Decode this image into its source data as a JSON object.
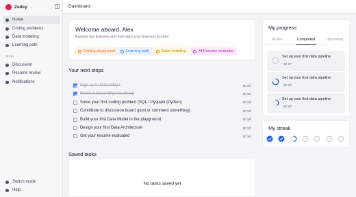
{
  "app": {
    "name": "Zedsy"
  },
  "sidebar": {
    "items": [
      {
        "label": "Home",
        "active": true
      },
      {
        "label": "Coding problems"
      },
      {
        "label": "Data modeling"
      },
      {
        "label": "Learning path"
      }
    ],
    "more_label": "More",
    "more_items": [
      {
        "label": "Discussion"
      },
      {
        "label": "Resume review"
      },
      {
        "label": "Notifications"
      }
    ],
    "bottom_items": [
      {
        "label": "Switch mode"
      },
      {
        "label": "Help"
      }
    ]
  },
  "header": {
    "title": "Dashboard"
  },
  "welcome": {
    "title": "Welcome aboard, Alex",
    "subtitle": "Explore our features and kick-start your learning journey",
    "chips": [
      {
        "label": "Coding playground",
        "color": "#f97316",
        "bg": "#fff1e6"
      },
      {
        "label": "Learning path",
        "color": "#3b82f6",
        "bg": "#e8f1fe"
      },
      {
        "label": "Data modeling",
        "color": "#eab308",
        "bg": "#fef6dc"
      },
      {
        "label": "AI Resume evaluator",
        "color": "#d946ef",
        "bg": "#fbe8fd"
      }
    ]
  },
  "next_steps": {
    "title": "Your next steps",
    "items": [
      {
        "label": "Sign up to Datavidhya",
        "xp": "50 XP",
        "done": true
      },
      {
        "label": "Enroll in Datavidhya roadmap",
        "xp": "50 XP",
        "done": true
      },
      {
        "label": "Solve your first coding problem (SQL / Pyspark (Python)",
        "xp": "50 XP",
        "done": false
      },
      {
        "label": "Contribute to discussion board (post or comment something)",
        "xp": "50 XP",
        "done": false
      },
      {
        "label": "Build your first Data Model in the playground",
        "xp": "50 XP",
        "done": false
      },
      {
        "label": "Design your first Data Architecture",
        "xp": "50 XP",
        "done": false
      },
      {
        "label": "Get your resume evaluated",
        "xp": "50 XP",
        "done": false
      }
    ]
  },
  "saved_tasks": {
    "title": "Saved tasks",
    "empty_text": "No tasks saved yet"
  },
  "progress": {
    "title": "My progress",
    "tabs": [
      {
        "label": "Active"
      },
      {
        "label": "Completed",
        "active": true
      },
      {
        "label": "Upcoming"
      }
    ],
    "cards": [
      {
        "title": "Set up your first data pipeline",
        "xp": "50 XP",
        "fill": 0
      },
      {
        "title": "Set up your first data pipeline",
        "xp": "50 XP",
        "fill": 0.75
      },
      {
        "title": "Set up your first data pipeline",
        "xp": "50 XP",
        "fill": 0.4
      }
    ]
  },
  "streak": {
    "title": "My streak",
    "days": [
      1,
      1,
      0.5,
      0,
      0,
      0,
      0
    ]
  }
}
